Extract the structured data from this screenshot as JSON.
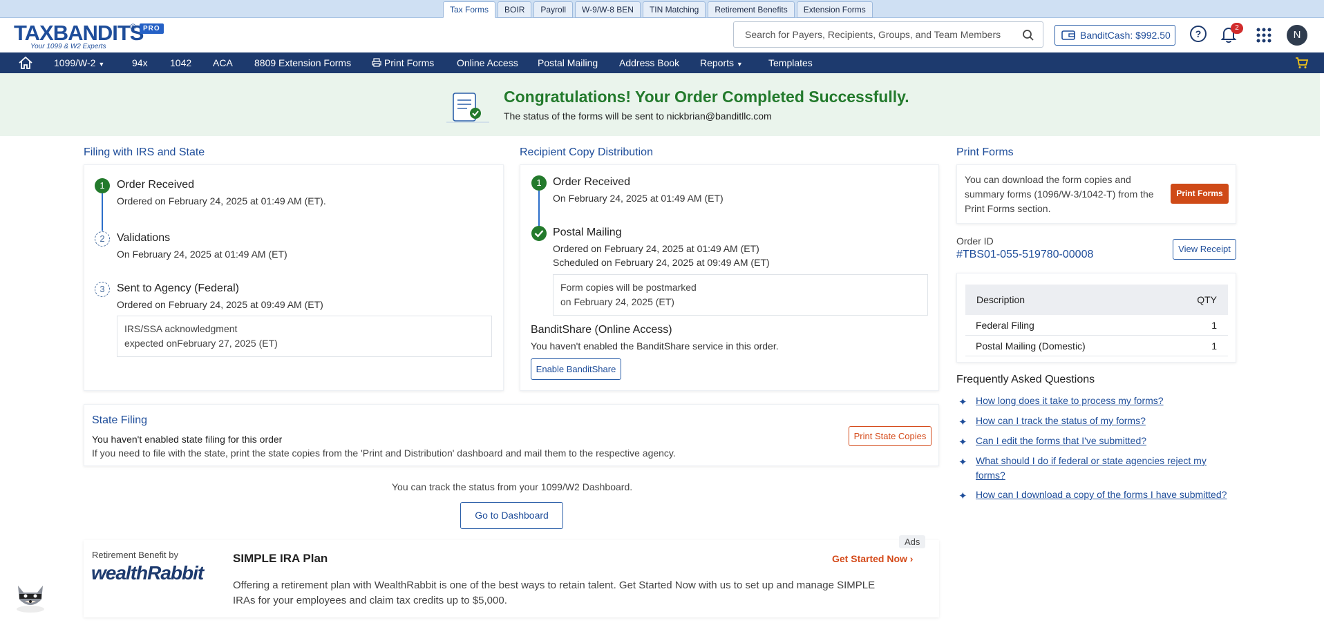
{
  "top_tabs": [
    "Tax Forms",
    "BOIR",
    "Payroll",
    "W-9/W-8 BEN",
    "TIN Matching",
    "Retirement Benefits",
    "Extension Forms"
  ],
  "logo": {
    "brand": "TAXBANDITS",
    "registered": "®",
    "badge": "PRO",
    "tagline": "Your 1099 & W2 Experts"
  },
  "search": {
    "placeholder": "Search for Payers, Recipients, Groups, and Team Members"
  },
  "bandit_cash": "BanditCash: $992.50",
  "notifications_count": "2",
  "avatar_initial": "N",
  "nav": {
    "items": [
      "1099/W-2",
      "94x",
      "1042",
      "ACA",
      "8809 Extension Forms",
      "Print Forms",
      "Online Access",
      "Postal Mailing",
      "Address Book",
      "Reports",
      "Templates"
    ]
  },
  "banner": {
    "title": "Congratulations! Your Order Completed Successfully.",
    "subtitle_prefix": "The status of the forms will be sent to",
    "email": "nickbrian@banditllc.com"
  },
  "filing": {
    "heading": "Filing with IRS and State",
    "steps": [
      {
        "num": "1",
        "title": "Order Received",
        "detail": "Ordered on February 24, 2025 at 01:49 AM (ET)."
      },
      {
        "num": "2",
        "title": "Validations",
        "detail": "On February 24, 2025 at 01:49 AM (ET)"
      },
      {
        "num": "3",
        "title": "Sent to Agency (Federal)",
        "detail": "Ordered on February 24, 2025 at 09:49 AM (ET)"
      }
    ],
    "note_line1": "IRS/SSA acknowledgment",
    "note_line2": "expected onFebruary 27, 2025 (ET)"
  },
  "recipient": {
    "heading": "Recipient Copy Distribution",
    "step1_num": "1",
    "step1_title": "Order Received",
    "step1_detail": "On February 24, 2025 at 01:49 AM (ET)",
    "step2_title": "Postal Mailing",
    "step2_detail1": "Ordered on February 24, 2025 at 01:49 AM (ET)",
    "step2_detail2": "Scheduled on February 24, 2025 at 09:49 AM (ET)",
    "note_line1": "Form copies will be postmarked",
    "note_line2": "on February 24, 2025 (ET)",
    "share_title": "BanditShare (Online Access)",
    "share_detail": "You haven't enabled the BanditShare service in this order.",
    "share_button": "Enable BanditShare"
  },
  "print_forms": {
    "heading": "Print Forms",
    "text_line1": "You can download the form copies and",
    "text_line2": "summary forms (1096/W-3/1042-T) from the",
    "text_line3": "Print Forms section.",
    "button": "Print Forms"
  },
  "order": {
    "label": "Order ID",
    "id": "#TBS01-055-519780-00008",
    "receipt_button": "View Receipt",
    "table_headers": {
      "description": "Description",
      "qty": "QTY"
    },
    "rows": [
      {
        "description": "Federal Filing",
        "qty": "1"
      },
      {
        "description": "Postal Mailing (Domestic)",
        "qty": "1"
      }
    ]
  },
  "faq": {
    "heading": "Frequently Asked Questions",
    "items": [
      "How long does it take to process my forms?",
      "How can I track the status of my forms?",
      "Can I edit the forms that I've submitted?",
      "What should I do if federal or state agencies reject my forms?",
      "How can I download a copy of the forms I have submitted?"
    ]
  },
  "state": {
    "heading": "State Filing",
    "line1": "You haven't enabled state filing for this order",
    "line2": "If you need to file with the state, print the state copies from the 'Print and Distribution' dashboard and mail them to the respective agency.",
    "button": "Print State Copies"
  },
  "track": {
    "text": "You can track the status from your 1099/W2 Dashboard.",
    "button": "Go to Dashboard"
  },
  "ad": {
    "label": "Ads",
    "by": "Retirement Benefit by",
    "brand": "wealthRabbit",
    "title": "SIMPLE IRA Plan",
    "cta": "Get Started Now",
    "body_line1": "Offering a retirement plan with WealthRabbit is one of the best ways to retain talent. Get Started Now with us to set up and manage SIMPLE",
    "body_line2": "IRAs for your employees and claim tax credits up to $5,000."
  }
}
